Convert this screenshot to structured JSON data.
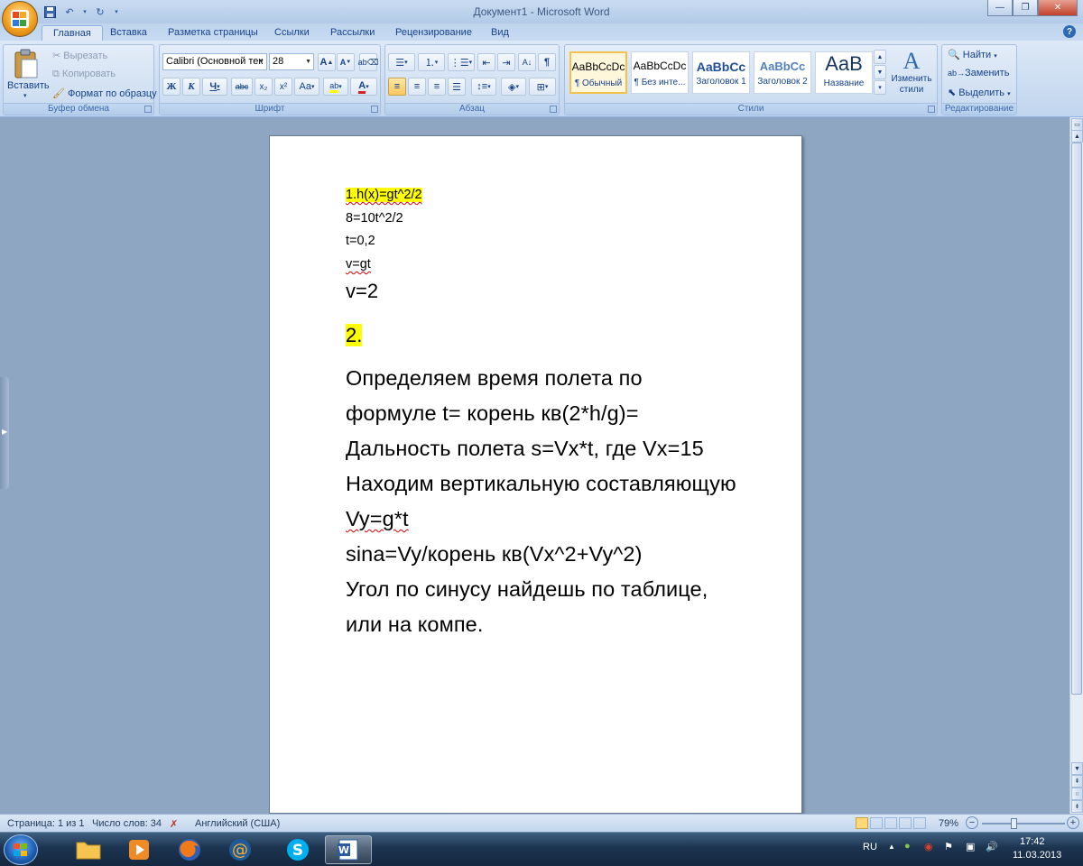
{
  "window": {
    "title": "Документ1 - Microsoft Word"
  },
  "tabs": [
    "Главная",
    "Вставка",
    "Разметка страницы",
    "Ссылки",
    "Рассылки",
    "Рецензирование",
    "Вид"
  ],
  "clipboard": {
    "paste": "Вставить",
    "cut": "Вырезать",
    "copy": "Копировать",
    "format_painter": "Формат по образцу",
    "group_label": "Буфер обмена"
  },
  "font": {
    "name": "Calibri (Основной тек",
    "size": "28",
    "bold": "Ж",
    "italic": "К",
    "underline": "Ч",
    "strike": "abc",
    "subscript": "x₂",
    "superscript": "x²",
    "change_case": "Aa",
    "grow": "A",
    "shrink": "A",
    "group_label": "Шрифт"
  },
  "paragraph": {
    "group_label": "Абзац"
  },
  "styles": {
    "items": [
      {
        "sample": "AaBbCcDc",
        "name": "¶ Обычный"
      },
      {
        "sample": "AaBbCcDc",
        "name": "¶ Без инте..."
      },
      {
        "sample": "AaBbCc",
        "name": "Заголовок 1"
      },
      {
        "sample": "AaBbCc",
        "name": "Заголовок 2"
      },
      {
        "sample": "AaB",
        "name": "Название"
      }
    ],
    "change": "Изменить стили",
    "group_label": "Стили"
  },
  "editing": {
    "find": "Найти",
    "replace": "Заменить",
    "select": "Выделить",
    "group_label": "Редактирование"
  },
  "document": {
    "lines": [
      "1.h(x)=gt^2/2",
      "8=10t^2/2",
      "t=0,2",
      "v=gt",
      "v=2",
      "2.",
      "Определяем время полета по",
      "формуле t= корень кв(2*h/g)=",
      "Дальность полета s=Vx*t, где Vx=15",
      "Находим вертикальную составляющую",
      "Vy=g*t",
      "sina=Vy/корень кв(Vx^2+Vy^2)",
      "Угол по синусу найдешь по таблице,",
      "или на компе."
    ]
  },
  "status": {
    "page": "Страница: 1 из 1",
    "words": "Число слов: 34",
    "language": "Английский (США)",
    "zoom": "79%"
  },
  "taskbar": {
    "lang": "RU",
    "time": "17:42",
    "date": "11.03.2013"
  }
}
